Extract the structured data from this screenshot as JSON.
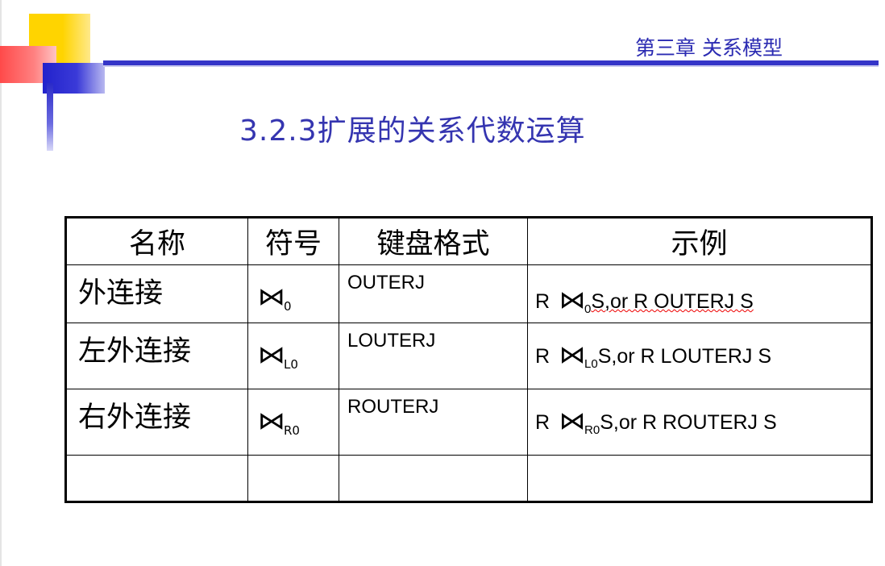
{
  "header": {
    "chapter": "第三章 关系模型",
    "title": "3.2.3扩展的关系代数运算"
  },
  "table": {
    "headers": [
      "名称",
      "符号",
      "键盘格式",
      "示例"
    ],
    "rows": [
      {
        "name": "外连接",
        "symbol": "⋈",
        "symbol_sub": "0",
        "keyboard": "OUTERJ",
        "example_r": "R",
        "example_join": "⋈",
        "example_sub": "0",
        "example_tail": "S,or R OUTERJ S"
      },
      {
        "name": "左外连接",
        "symbol": "⋈",
        "symbol_sub": "L0",
        "keyboard": "LOUTERJ",
        "example_r": "R",
        "example_join": "⋈",
        "example_sub": "L0",
        "example_tail": "S,or R LOUTERJ S"
      },
      {
        "name": "右外连接",
        "symbol": "⋈",
        "symbol_sub": "R0",
        "keyboard": "ROUTERJ",
        "example_r": "R",
        "example_join": "⋈",
        "example_sub": "R0",
        "example_tail": "S,or R ROUTERJ S"
      }
    ]
  },
  "colors": {
    "accent_blue": "#3535c8",
    "title_blue": "#3535b0",
    "deco_yellow": "#ffd400",
    "deco_red": "#ff4a4a"
  }
}
